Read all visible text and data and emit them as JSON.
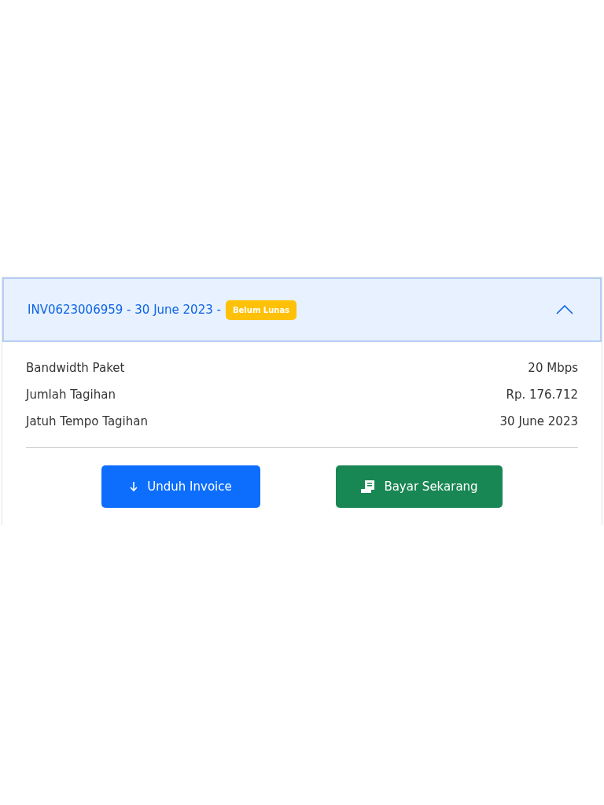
{
  "invoice": {
    "title": "INV0623006959 - 30 June 2023 -",
    "status_badge": "Belum Lunas",
    "expanded": true,
    "details": [
      {
        "label": "Bandwidth Paket",
        "value": "20 Mbps"
      },
      {
        "label": "Jumlah Tagihan",
        "value": "Rp. 176.712"
      },
      {
        "label": "Jatuh Tempo Tagihan",
        "value": "30 June 2023"
      }
    ],
    "buttons": [
      {
        "kind": "download",
        "label": "Unduh Invoice"
      },
      {
        "kind": "pay",
        "label": "Bayar Sekarang"
      }
    ]
  }
}
